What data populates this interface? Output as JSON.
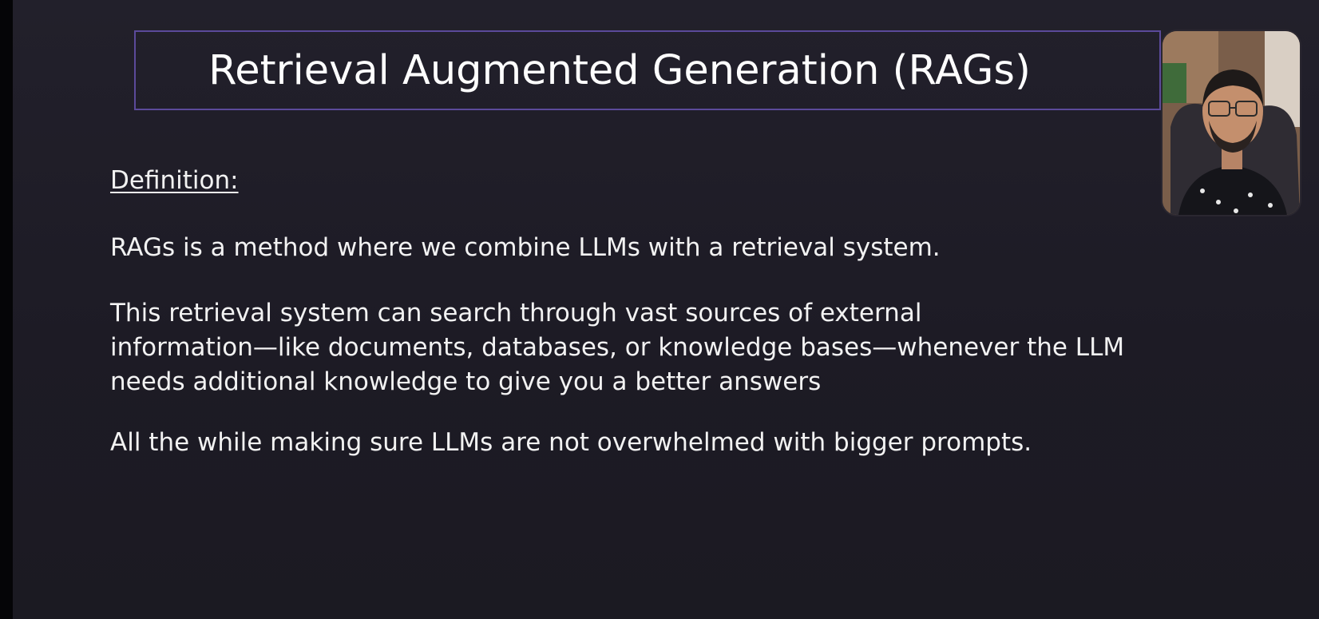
{
  "slide": {
    "title": "Retrieval Augmented Generation (RAGs)",
    "definition_heading": "Definition:",
    "paragraph_1": "RAGs is a method where we combine LLMs with a retrieval system.",
    "paragraph_2_lines": [
      "This retrieval system can search through vast sources of external",
      "information—like documents, databases, or knowledge bases—whenever the LLM",
      "needs additional knowledge to give you a better answers"
    ],
    "paragraph_3": "All the while making sure LLMs are not overwhelmed with bigger prompts."
  },
  "colors": {
    "background": "#1f1d27",
    "title_border": "#5b4a9a",
    "text": "#ffffff"
  },
  "webcam": {
    "icon": "presenter-webcam-icon"
  }
}
